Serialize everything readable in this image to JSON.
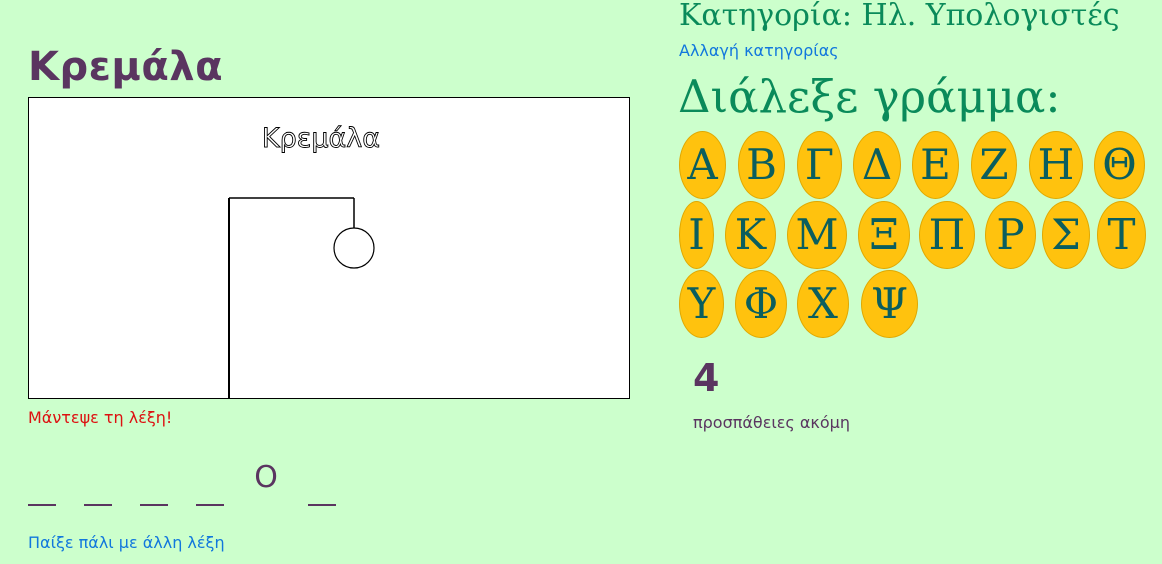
{
  "game": {
    "title": "Κρεμάλα",
    "canvas_title": "Κρεμάλα",
    "message": "Μάντεψε τη λέξη!",
    "play_again": "Παίξε πάλι με άλλη λέξη",
    "tries_left": "4",
    "tries_label": "προσπάθειες ακόμη"
  },
  "word": [
    "",
    "",
    "",
    "",
    "Ο",
    ""
  ],
  "category": {
    "label": "Κατηγορία: Ηλ. Υπολογιστές",
    "change": "Αλλαγή κατηγορίας"
  },
  "picker": {
    "label": "Διάλεξε γράμμα:",
    "letters": [
      "Α",
      "Β",
      "Γ",
      "Δ",
      "Ε",
      "Ζ",
      "Η",
      "Θ",
      "Ι",
      "Κ",
      "Μ",
      "Ξ",
      "Π",
      "Ρ",
      "Σ",
      "Τ",
      "Υ",
      "Φ",
      "Χ",
      "Ψ"
    ]
  },
  "colors": {
    "background": "#ccffcc",
    "title": "#5a3560",
    "accent_green": "#0a8a5a",
    "link": "#1177dd",
    "error": "#dd1111",
    "letter_button": "#ffc20e"
  }
}
